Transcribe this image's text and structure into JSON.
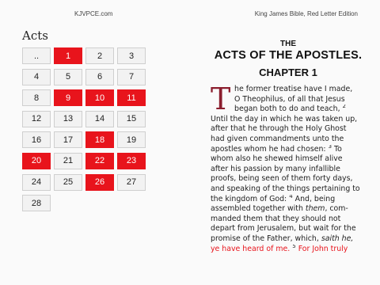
{
  "header": {
    "site": "KJVPCE.com",
    "edition": "King James Bible, Red Letter Edition"
  },
  "book_title": "Acts",
  "chapter_grid": [
    {
      "label": "..",
      "red": false
    },
    {
      "label": "1",
      "red": true
    },
    {
      "label": "2",
      "red": false
    },
    {
      "label": "3",
      "red": false
    },
    {
      "label": "4",
      "red": false
    },
    {
      "label": "5",
      "red": false
    },
    {
      "label": "6",
      "red": false
    },
    {
      "label": "7",
      "red": false
    },
    {
      "label": "8",
      "red": false
    },
    {
      "label": "9",
      "red": true
    },
    {
      "label": "10",
      "red": true
    },
    {
      "label": "11",
      "red": true
    },
    {
      "label": "12",
      "red": false
    },
    {
      "label": "13",
      "red": false
    },
    {
      "label": "14",
      "red": false
    },
    {
      "label": "15",
      "red": false
    },
    {
      "label": "16",
      "red": false
    },
    {
      "label": "17",
      "red": false
    },
    {
      "label": "18",
      "red": true
    },
    {
      "label": "19",
      "red": false
    },
    {
      "label": "20",
      "red": true
    },
    {
      "label": "21",
      "red": false
    },
    {
      "label": "22",
      "red": true
    },
    {
      "label": "23",
      "red": true
    },
    {
      "label": "24",
      "red": false
    },
    {
      "label": "25",
      "red": false
    },
    {
      "label": "26",
      "red": true
    },
    {
      "label": "27",
      "red": false
    },
    {
      "label": "28",
      "red": false
    }
  ],
  "content": {
    "the": "THE",
    "book_heading": "ACTS OF THE APOSTLES.",
    "chapter_heading": "CHAPTER 1",
    "drop_cap": "T",
    "dropcap_lines": [
      "he former treatise have I made,",
      "O Theophilus, of all that Jesus"
    ],
    "line3_text": "began both to do and teach,",
    "verse_2": "2",
    "line4": "Until the day in which he was taken up,",
    "line5": "after that he through the Holy Ghost",
    "line6": "had given commandments unto the",
    "line7_text": "apostles whom he had chosen:",
    "verse_3": "3",
    "line7_tail": "To",
    "line8": "whom also he shewed himself alive",
    "line9": "after his passion by many infallible",
    "line10": "proofs, being seen of them forty days,",
    "line11": "and speaking of the things pertaining to",
    "line12_text": "the kingdom of God:",
    "verse_4": "4",
    "line12_tail": "And, being",
    "line13_a": "assembled together with",
    "line13_italic": "them",
    "line13_b": ", com-",
    "line14": "manded them that they should not",
    "line15": "depart from Jerusalem, but wait for the",
    "line16_a": "promise of the Father, which,",
    "line16_italic": "saith he,",
    "line17_red": "ye have heard of me.",
    "verse_5": "5",
    "line17_red_tail": "For John truly"
  },
  "colors": {
    "accent_red": "#e8141c",
    "drop_cap": "#8b1e2e"
  }
}
